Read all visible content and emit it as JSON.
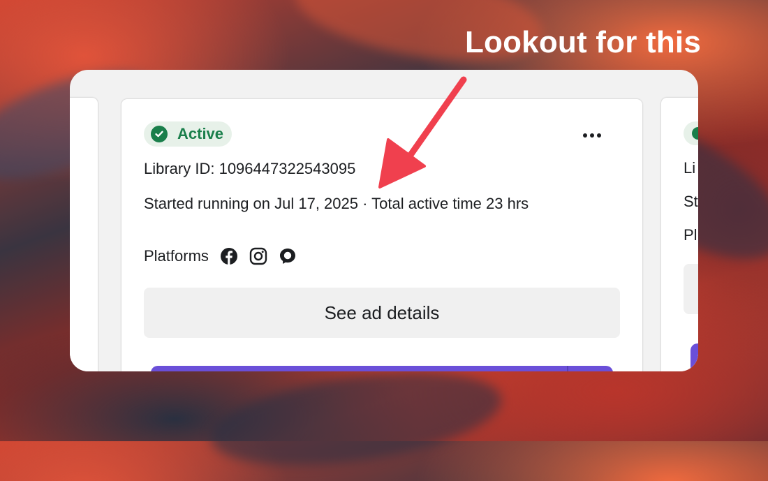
{
  "annotation": {
    "headline": "Lookout for this"
  },
  "ad_card": {
    "status": "Active",
    "library_id": "Library ID: 1096447322543095",
    "started": "Started running on Jul 17, 2025 · Total active time 23 hrs",
    "platforms_label": "Platforms",
    "platform_icons": [
      "facebook-icon",
      "instagram-icon",
      "messenger-icon"
    ],
    "details_button": "See ad details"
  },
  "next_card": {
    "line1": "Li",
    "line2": "St",
    "line3": "Pl"
  },
  "colors": {
    "active_green": "#1a7f4b",
    "badge_bg": "#e7f1e9",
    "cta_purple": "#6a4fd8",
    "arrow_red": "#f0404e"
  }
}
